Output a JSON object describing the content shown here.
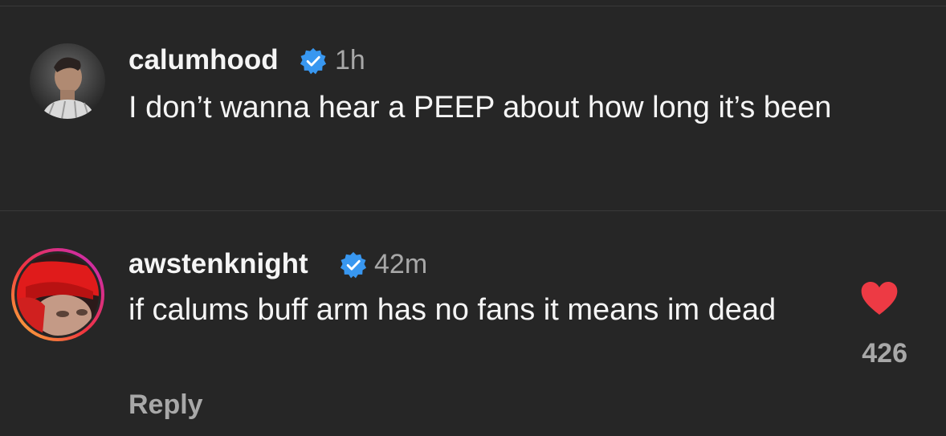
{
  "comments": [
    {
      "username": "calumhood",
      "verified": true,
      "time": "1h",
      "text": "I don’t wanna hear a PEEP about how long it’s been",
      "avatar_icon": "profile-photo"
    },
    {
      "username": "awstenknight",
      "verified": true,
      "time": "42m",
      "text": "if calums buff arm has no fans it means im dead",
      "avatar_icon": "profile-photo-story-ring",
      "reply_label": "Reply",
      "likes": "426",
      "liked": true
    }
  ],
  "colors": {
    "background": "#262626",
    "verified_badge": "#3897f0",
    "like_heart": "#ed3a44",
    "secondary_text": "#a8a8a8"
  }
}
